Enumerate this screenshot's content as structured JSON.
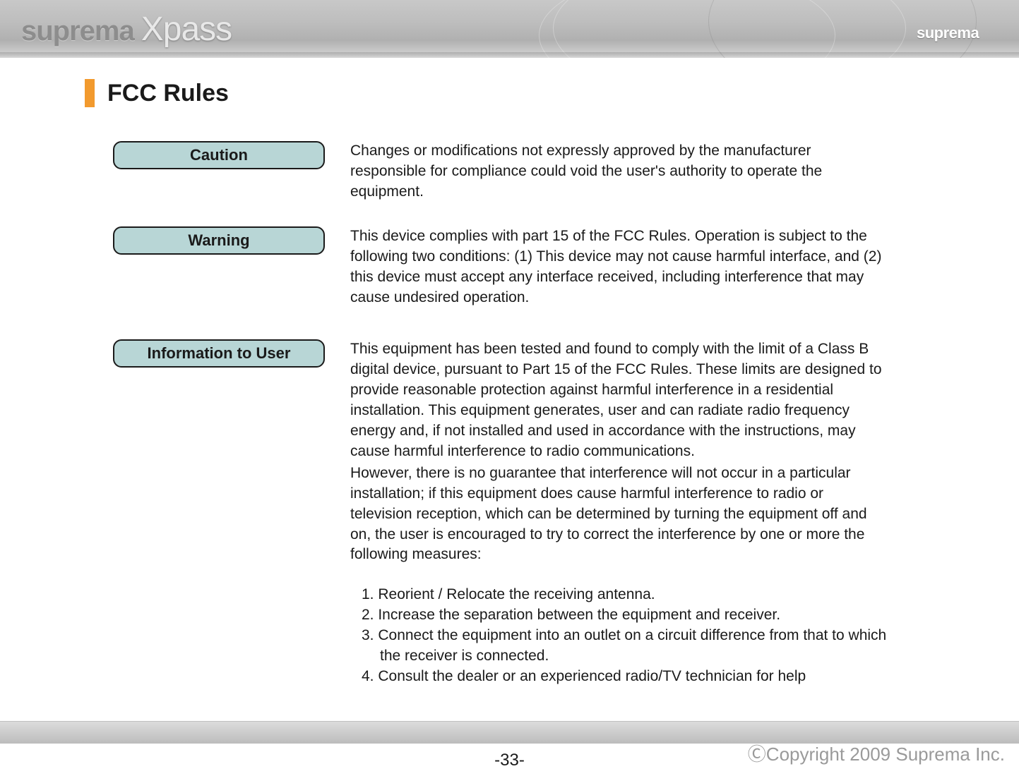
{
  "header": {
    "brand_prefix": "suprema",
    "brand_product": "Xpass",
    "badge_text": "suprema"
  },
  "page": {
    "title": "FCC Rules",
    "number": "-33-",
    "copyright": "ⒸCopyright 2009 Suprema Inc."
  },
  "sections": [
    {
      "label": "Caution",
      "body": "Changes or modifications not expressly approved by the manufacturer responsible for compliance could void the user's authority to operate the equipment."
    },
    {
      "label": "Warning",
      "body": "This device complies with part 15 of the FCC Rules. Operation is subject to the following two conditions: (1) This device may not cause harmful interface, and (2) this device must accept any interface received, including interference that may cause undesired operation."
    },
    {
      "label": "Information to User",
      "body_p1": "This equipment has been tested and found to comply with the limit of a Class B digital device, pursuant to Part 15 of the FCC Rules. These limits are designed to provide reasonable protection against harmful interference in a residential installation. This equipment generates, user and can  radiate radio frequency energy and, if not installed and used in accordance with the instructions, may cause harmful interference to radio communications.",
      "body_p2": "However, there is no guarantee that interference will not occur in a particular installation; if this equipment does cause harmful interference to radio or television reception, which can be determined by turning the equipment off and on, the user is encouraged to try to correct the interference by one or more the following measures:",
      "measures": [
        "1. Reorient / Relocate the receiving antenna.",
        "2. Increase the separation between the equipment and receiver.",
        "3. Connect the equipment into an outlet on a circuit difference from that to which the receiver is connected.",
        "4. Consult the dealer or an experienced radio/TV technician for help"
      ]
    }
  ]
}
